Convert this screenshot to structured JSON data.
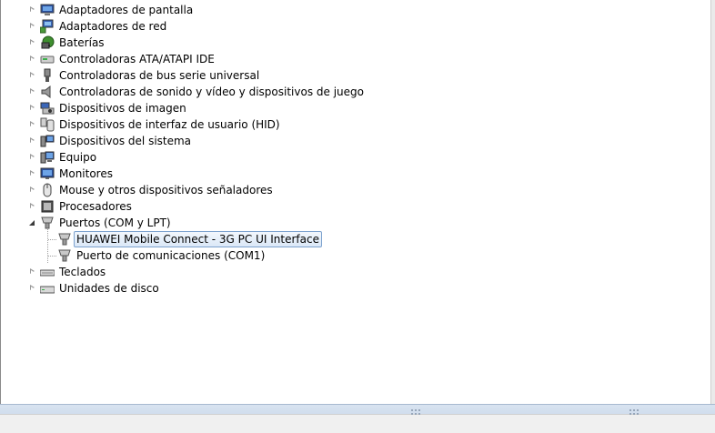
{
  "tree": {
    "items": [
      {
        "label": "Adaptadores de pantalla",
        "state": "collapsed",
        "icon": "display-adapter-icon"
      },
      {
        "label": "Adaptadores de red",
        "state": "collapsed",
        "icon": "network-adapter-icon"
      },
      {
        "label": "Baterías",
        "state": "collapsed",
        "icon": "battery-icon"
      },
      {
        "label": "Controladoras ATA/ATAPI IDE",
        "state": "collapsed",
        "icon": "ide-controller-icon"
      },
      {
        "label": "Controladoras de bus serie universal",
        "state": "collapsed",
        "icon": "usb-controller-icon"
      },
      {
        "label": "Controladoras de sonido y vídeo y dispositivos de juego",
        "state": "collapsed",
        "icon": "sound-video-icon"
      },
      {
        "label": "Dispositivos de imagen",
        "state": "collapsed",
        "icon": "imaging-device-icon"
      },
      {
        "label": "Dispositivos de interfaz de usuario (HID)",
        "state": "collapsed",
        "icon": "hid-device-icon"
      },
      {
        "label": "Dispositivos del sistema",
        "state": "collapsed",
        "icon": "system-device-icon"
      },
      {
        "label": "Equipo",
        "state": "collapsed",
        "icon": "computer-icon"
      },
      {
        "label": "Monitores",
        "state": "collapsed",
        "icon": "monitor-icon"
      },
      {
        "label": "Mouse y otros dispositivos señaladores",
        "state": "collapsed",
        "icon": "mouse-icon"
      },
      {
        "label": "Procesadores",
        "state": "collapsed",
        "icon": "processor-icon"
      },
      {
        "label": "Puertos (COM y LPT)",
        "state": "expanded",
        "icon": "port-icon"
      },
      {
        "label": "HUAWEI Mobile Connect - 3G PC UI Interface",
        "state": "child",
        "selected": true,
        "icon": "port-icon"
      },
      {
        "label": "Puerto de comunicaciones (COM1)",
        "state": "child",
        "icon": "port-icon"
      },
      {
        "label": "Teclados",
        "state": "collapsed",
        "icon": "keyboard-icon"
      },
      {
        "label": "Unidades de disco",
        "state": "collapsed",
        "icon": "disk-drive-icon"
      }
    ]
  },
  "colors": {
    "selection_border": "#7da2ce",
    "selection_fill": "#dbe8f7"
  }
}
